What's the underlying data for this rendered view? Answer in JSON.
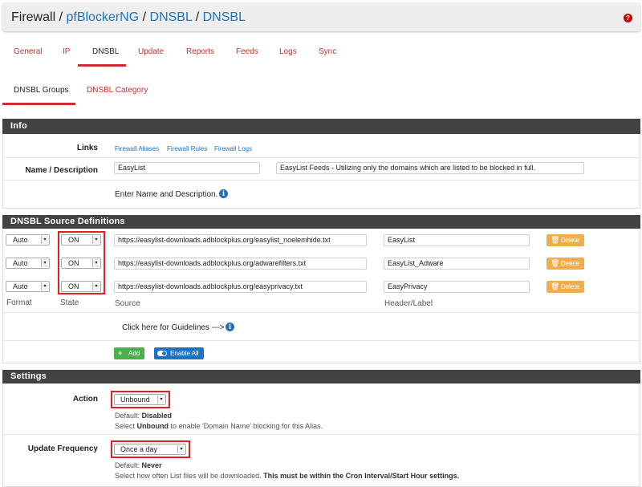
{
  "breadcrumb": [
    "Firewall",
    "pfBlockerNG",
    "DNSBL",
    "DNSBL"
  ],
  "help_icon": "question-circle-icon",
  "tabs": [
    "General",
    "IP",
    "DNSBL",
    "Update",
    "Reports",
    "Feeds",
    "Logs",
    "Sync"
  ],
  "active_tab": "DNSBL",
  "subtabs": [
    "DNSBL Groups",
    "DNSBL Category"
  ],
  "active_subtab": "DNSBL Groups",
  "colors": {
    "accent": "#c9302c",
    "link": "#1e73be",
    "panel_header": "#424242",
    "highlight": "#e31e24"
  },
  "info": {
    "title": "Info",
    "links_label": "Links",
    "links": [
      "Firewall Aliases",
      "Firewall Rules",
      "Firewall Logs"
    ],
    "name_label": "Name / Description",
    "name_value": "EasyList",
    "description_value": "EasyList Feeds - Utilizing only the domains which are listed to be blocked in full.",
    "help_text": "Enter Name and Description."
  },
  "sources": {
    "title": "DNSBL Source Definitions",
    "rows": [
      {
        "format": "Auto",
        "state": "ON",
        "source": "https://easylist-downloads.adblockplus.org/easylist_noelemhide.txt",
        "label": "EasyList"
      },
      {
        "format": "Auto",
        "state": "ON",
        "source": "https://easylist-downloads.adblockplus.org/adwarefilters.txt",
        "label": "EasyList_Adware"
      },
      {
        "format": "Auto",
        "state": "ON",
        "source": "https://easylist-downloads.adblockplus.org/easyprivacy.txt",
        "label": "EasyPrivacy"
      }
    ],
    "delete_label": "Delete",
    "col_format": "Format",
    "col_state": "State",
    "col_source": "Source",
    "col_label": "Header/Label",
    "guidelines_text": "Click here for Guidelines --->",
    "add_label": "Add",
    "enable_all_label": "Enable All"
  },
  "settings": {
    "title": "Settings",
    "action_label": "Action",
    "action_value": "Unbound",
    "action_default_prefix": "Default:",
    "action_default_value": "Disabled",
    "action_help_pre": "Select",
    "action_help_bold": "Unbound",
    "action_help_post": "to enable 'Domain Name' blocking for this Alias.",
    "update_label": "Update Frequency",
    "update_value": "Once a day",
    "update_default_prefix": "Default:",
    "update_default_value": "Never",
    "update_help_pre": "Select how often List files will be downloaded.",
    "update_help_bold": "This must be within the Cron Interval/Start Hour settings."
  }
}
